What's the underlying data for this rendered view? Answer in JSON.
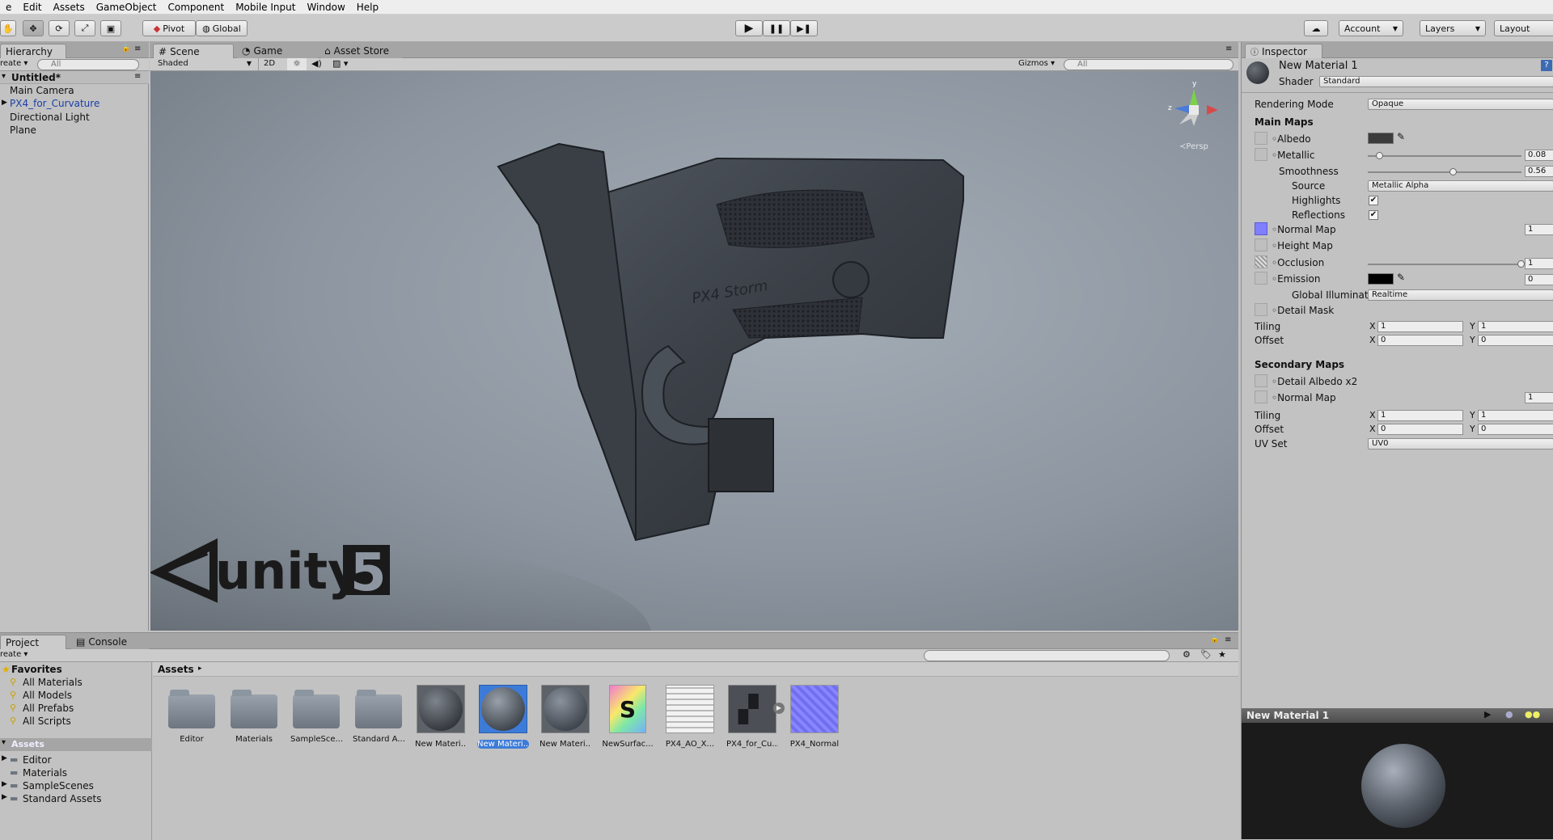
{
  "menu": [
    "e",
    "Edit",
    "Assets",
    "GameObject",
    "Component",
    "Mobile Input",
    "Window",
    "Help"
  ],
  "toolbar": {
    "pivot": "Pivot",
    "global": "Global",
    "account": "Account",
    "layers": "Layers",
    "layout": "Layout"
  },
  "hierarchy": {
    "tab": "Hierarchy",
    "create": "reate",
    "search_placeholder": "All",
    "scene_name": "Untitled*",
    "items": [
      "Main Camera",
      "PX4_for_Curvature",
      "Directional Light",
      "Plane"
    ]
  },
  "scene": {
    "tabs": [
      "Scene",
      "Game",
      "Asset Store"
    ],
    "shading": "Shaded",
    "mode2d": "2D",
    "gizmos": "Gizmos",
    "search_placeholder": "All",
    "persp": "Persp",
    "axis_y": "y",
    "axis_z": "z",
    "logo_text": "unity",
    "logo_num": "5",
    "gun_text": "PX4 Storm"
  },
  "inspector": {
    "tab": "Inspector",
    "material_name": "New Material 1",
    "shader_label": "Shader",
    "shader_value": "Standard",
    "rendering_mode_label": "Rendering Mode",
    "rendering_mode_value": "Opaque",
    "main_maps": "Main Maps",
    "albedo": "Albedo",
    "metallic": "Metallic",
    "metallic_value": "0.08",
    "metallic_level": 0.08,
    "smoothness": "Smoothness",
    "smoothness_value": "0.56",
    "smoothness_level": 0.56,
    "source": "Source",
    "source_value": "Metallic Alpha",
    "highlights": "Highlights",
    "reflections": "Reflections",
    "normal_map": "Normal Map",
    "normal_map_value": "1",
    "height_map": "Height Map",
    "occlusion": "Occlusion",
    "occlusion_value": "1",
    "emission": "Emission",
    "emission_value": "0",
    "global_illum": "Global Illuminat",
    "global_illum_value": "Realtime",
    "detail_mask": "Detail Mask",
    "tiling": "Tiling",
    "offset": "Offset",
    "x": "X",
    "y": "Y",
    "tiling_x": "1",
    "tiling_y": "1",
    "offset_x": "0",
    "offset_y": "0",
    "secondary_maps": "Secondary Maps",
    "detail_albedo": "Detail Albedo x2",
    "sec_normal_map": "Normal Map",
    "sec_normal_value": "1",
    "sec_tiling_x": "1",
    "sec_tiling_y": "1",
    "sec_offset_x": "0",
    "sec_offset_y": "0",
    "uv_set": "UV Set",
    "uv_set_value": "UV0",
    "preview_title": "New Material 1"
  },
  "project": {
    "tabs": [
      "Project",
      "Console"
    ],
    "create": "reate",
    "favorites": "Favorites",
    "favorite_items": [
      "All Materials",
      "All Models",
      "All Prefabs",
      "All Scripts"
    ],
    "assets_header": "Assets",
    "asset_folders": [
      "Editor",
      "Materials",
      "SampleScenes",
      "Standard Assets"
    ],
    "breadcrumb": "Assets",
    "assets": [
      {
        "name": "Editor",
        "kind": "folder"
      },
      {
        "name": "Materials",
        "kind": "folder"
      },
      {
        "name": "SampleSce...",
        "kind": "folder"
      },
      {
        "name": "Standard A...",
        "kind": "folder"
      },
      {
        "name": "New Materi...",
        "kind": "material-textured"
      },
      {
        "name": "New Materi...",
        "kind": "material-selected"
      },
      {
        "name": "New Materi...",
        "kind": "material-plain"
      },
      {
        "name": "NewSurfac...",
        "kind": "shader"
      },
      {
        "name": "PX4_AO_X...",
        "kind": "texture-ao"
      },
      {
        "name": "PX4_for_Cu...",
        "kind": "model"
      },
      {
        "name": "PX4_Normal",
        "kind": "texture-normal"
      }
    ],
    "shader_glyph": "S"
  },
  "colors": {
    "selection_blue": "#3d7bd9",
    "normal_map_purple": "#7f7fff",
    "hierarchy_blue": "#1b3fa6"
  }
}
